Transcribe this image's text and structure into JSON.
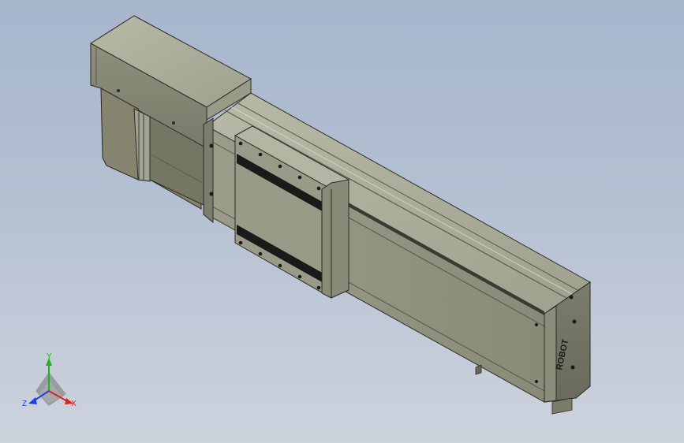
{
  "model": {
    "brand_logo_text": "ROBOT"
  },
  "triad": {
    "x_label": "X",
    "y_label": "Y",
    "z_label": "Z"
  },
  "colors": {
    "background_top": "#a7b6cc",
    "background_bottom": "#cdd3dd",
    "body_light": "#a9a997",
    "body_mid": "#8d8d7b",
    "body_dark": "#66665a",
    "edge": "#2b2b25",
    "axis_x": "#e02020",
    "axis_y": "#20b020",
    "axis_z": "#2040e0"
  }
}
